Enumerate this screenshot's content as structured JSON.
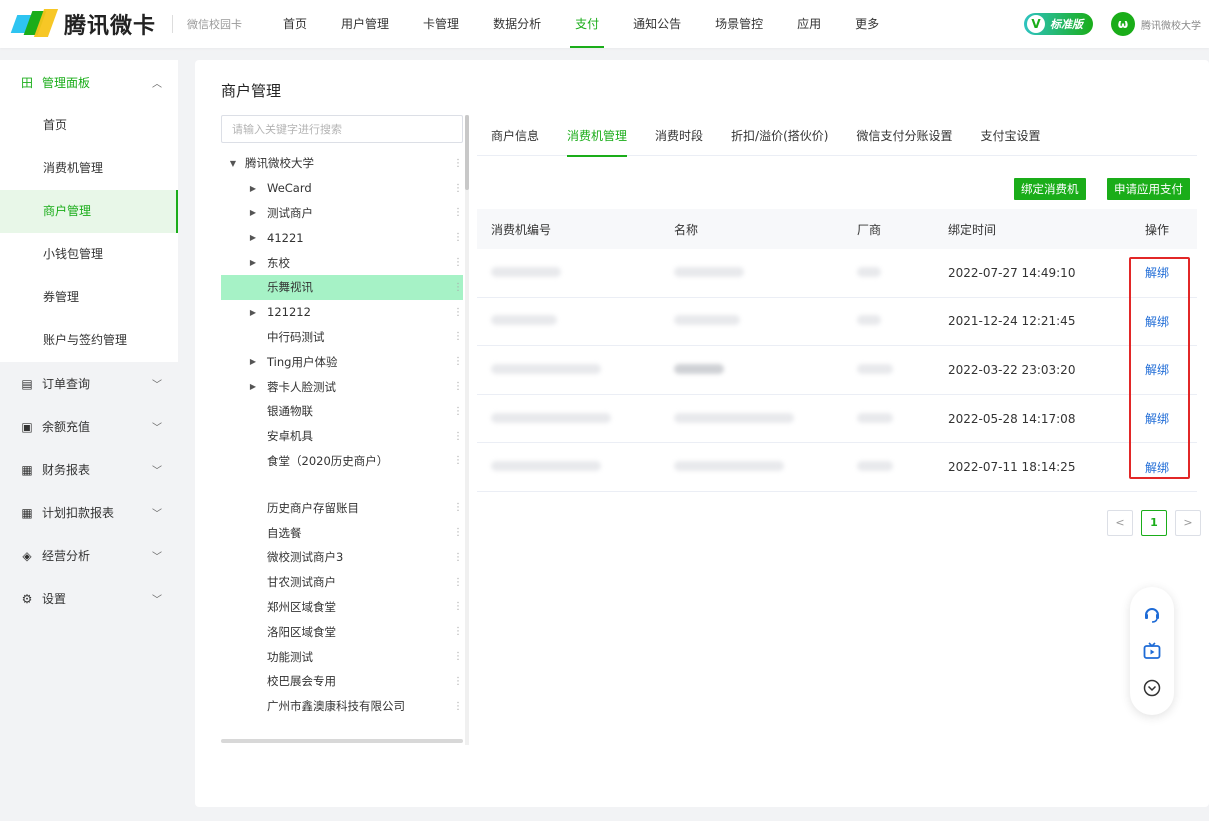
{
  "brand": {
    "name": "腾讯微卡",
    "sub": "微信校园卡"
  },
  "nav": [
    "首页",
    "用户管理",
    "卡管理",
    "数据分析",
    "支付",
    "通知公告",
    "场景管控",
    "应用",
    "更多"
  ],
  "nav_active": 4,
  "header": {
    "edition": "标准版",
    "edition_badge": "V",
    "school_logo": "ω",
    "school": "腾讯微校大学"
  },
  "sidebar": {
    "group_open": {
      "label": "管理面板",
      "icon": "田"
    },
    "sub_items": [
      "首页",
      "消费机管理",
      "商户管理",
      "小钱包管理",
      "券管理",
      "账户与签约管理"
    ],
    "sub_active": 2,
    "menus": [
      {
        "label": "订单查询",
        "icon": "▤"
      },
      {
        "label": "余额充值",
        "icon": "▣"
      },
      {
        "label": "财务报表",
        "icon": "▦"
      },
      {
        "label": "计划扣款报表",
        "icon": "▦"
      },
      {
        "label": "经营分析",
        "icon": "◈"
      },
      {
        "label": "设置",
        "icon": "⚙"
      }
    ]
  },
  "page": {
    "title": "商户管理"
  },
  "tree": {
    "search_placeholder": "请输入关键字进行搜索",
    "root": "腾讯微校大学",
    "nodes_a": [
      {
        "label": "WeCard",
        "expandable": true
      },
      {
        "label": "测试商户",
        "expandable": true
      },
      {
        "label": "41221",
        "expandable": true
      },
      {
        "label": "东校",
        "expandable": true
      },
      {
        "label": "乐舞视讯",
        "expandable": false,
        "selected": true
      },
      {
        "label": "121212",
        "expandable": true
      },
      {
        "label": "中行码测试",
        "expandable": false
      },
      {
        "label": "Ting用户体验",
        "expandable": true
      },
      {
        "label": "蓉卡人脸测试",
        "expandable": true
      },
      {
        "label": "银通物联",
        "expandable": false
      },
      {
        "label": "安卓机具",
        "expandable": false
      },
      {
        "label": "食堂（2020历史商户）",
        "expandable": false
      }
    ],
    "nodes_b": [
      {
        "label": "历史商户存留账目"
      },
      {
        "label": "自选餐"
      },
      {
        "label": "微校测试商户3"
      },
      {
        "label": "甘农测试商户"
      },
      {
        "label": "郑州区域食堂"
      },
      {
        "label": "洛阳区域食堂"
      },
      {
        "label": "功能测试"
      },
      {
        "label": "校巴展会专用"
      },
      {
        "label": "广州市鑫澳康科技有限公司"
      }
    ]
  },
  "tabs": [
    "商户信息",
    "消费机管理",
    "消费时段",
    "折扣/溢价(搭伙价)",
    "微信支付分账设置",
    "支付宝设置"
  ],
  "tab_active": 1,
  "buttons": {
    "bind": "绑定消费机",
    "apply": "申请应用支付"
  },
  "table": {
    "columns": [
      "消费机编号",
      "名称",
      "厂商",
      "绑定时间",
      "操作"
    ],
    "rows": [
      {
        "bind_time": "2022-07-27 14:49:10",
        "action": "解绑"
      },
      {
        "bind_time": "2021-12-24 12:21:45",
        "action": "解绑"
      },
      {
        "bind_time": "2022-03-22 23:03:20",
        "action": "解绑"
      },
      {
        "bind_time": "2022-05-28 14:17:08",
        "action": "解绑"
      },
      {
        "bind_time": "2022-07-11 18:14:25",
        "action": "解绑"
      }
    ]
  },
  "pager": {
    "prev": "<",
    "current": "1",
    "next": ">"
  },
  "colors": {
    "accent": "#1aad19",
    "link": "#1e6bd6",
    "highlight": "#e22727",
    "selected": "#a6f2c6"
  }
}
